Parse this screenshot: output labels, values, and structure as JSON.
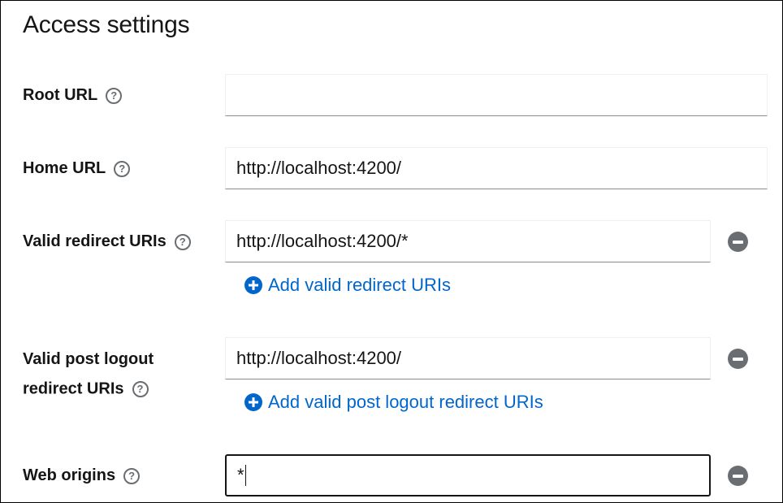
{
  "section": {
    "title": "Access settings"
  },
  "help_glyph": "?",
  "fields": {
    "root_url": {
      "label": "Root URL",
      "value": ""
    },
    "home_url": {
      "label": "Home URL",
      "value": "http://localhost:4200/"
    },
    "valid_redirect": {
      "label": "Valid redirect URIs",
      "value": "http://localhost:4200/*",
      "add_label": "Add valid redirect URIs"
    },
    "post_logout": {
      "label_line1": "Valid post logout",
      "label_line2": "redirect URIs",
      "value": "http://localhost:4200/",
      "add_label": "Add valid post logout redirect URIs"
    },
    "web_origins": {
      "label": "Web origins",
      "value": "*"
    }
  },
  "colors": {
    "link": "#0066cc",
    "icon_gray": "#6a6e73",
    "text": "#151515"
  },
  "icons": {
    "help": "help-circle-icon",
    "remove": "minus-circle-icon",
    "add": "plus-circle-icon"
  }
}
